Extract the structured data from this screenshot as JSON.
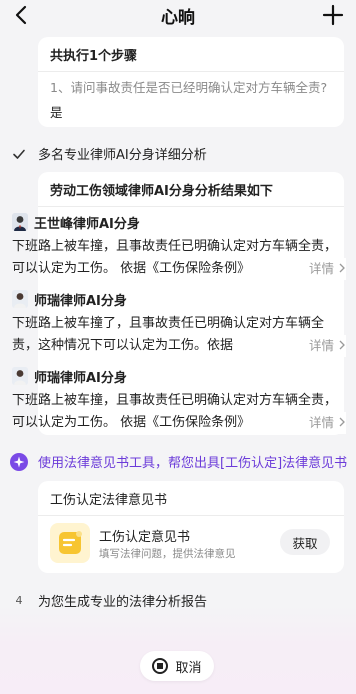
{
  "header": {
    "title": "心晌"
  },
  "summary": {
    "heading": "共执行1个步骤",
    "question": "1、请问事故责任是否已经明确认定对方车辆全责?",
    "answer": "是"
  },
  "steps": {
    "analysis_label": "多名专业律师AI分身详细分析",
    "tool_label": "使用法律意见书工具，帮您出具[工伤认定]法律意见书",
    "report_number": "4",
    "report_label": "为您生成专业的法律分析报告"
  },
  "analysis": {
    "heading": "劳动工伤领域律师AI分身分析结果如下",
    "lawyers": [
      {
        "name": "王世峰律师AI分身",
        "text": "下班路上被车撞，且事故责任已明确认定对方车辆全责，可以认定为工伤。 依据《工伤保险条例》",
        "more": "详情"
      },
      {
        "name": "师瑞律师AI分身",
        "text": "下班路上被车撞了，且事故责任已明确认定对方车辆全责，这种情况下可以认定为工伤。依据",
        "more": "详情"
      },
      {
        "name": "师瑞律师AI分身",
        "text": "下班路上被车撞，且事故责任已明确认定对方车辆全责，可以认定为工伤。 依据《工伤保险条例》",
        "more": "详情"
      }
    ]
  },
  "opinion": {
    "heading": "工伤认定法律意见书",
    "title": "工伤认定意见书",
    "subtitle": "填写法律问题，提供法律意见",
    "button": "获取"
  },
  "cancel": {
    "label": "取消"
  },
  "colors": {
    "accent": "#6b3bd9",
    "background": "#f4f4f6"
  }
}
